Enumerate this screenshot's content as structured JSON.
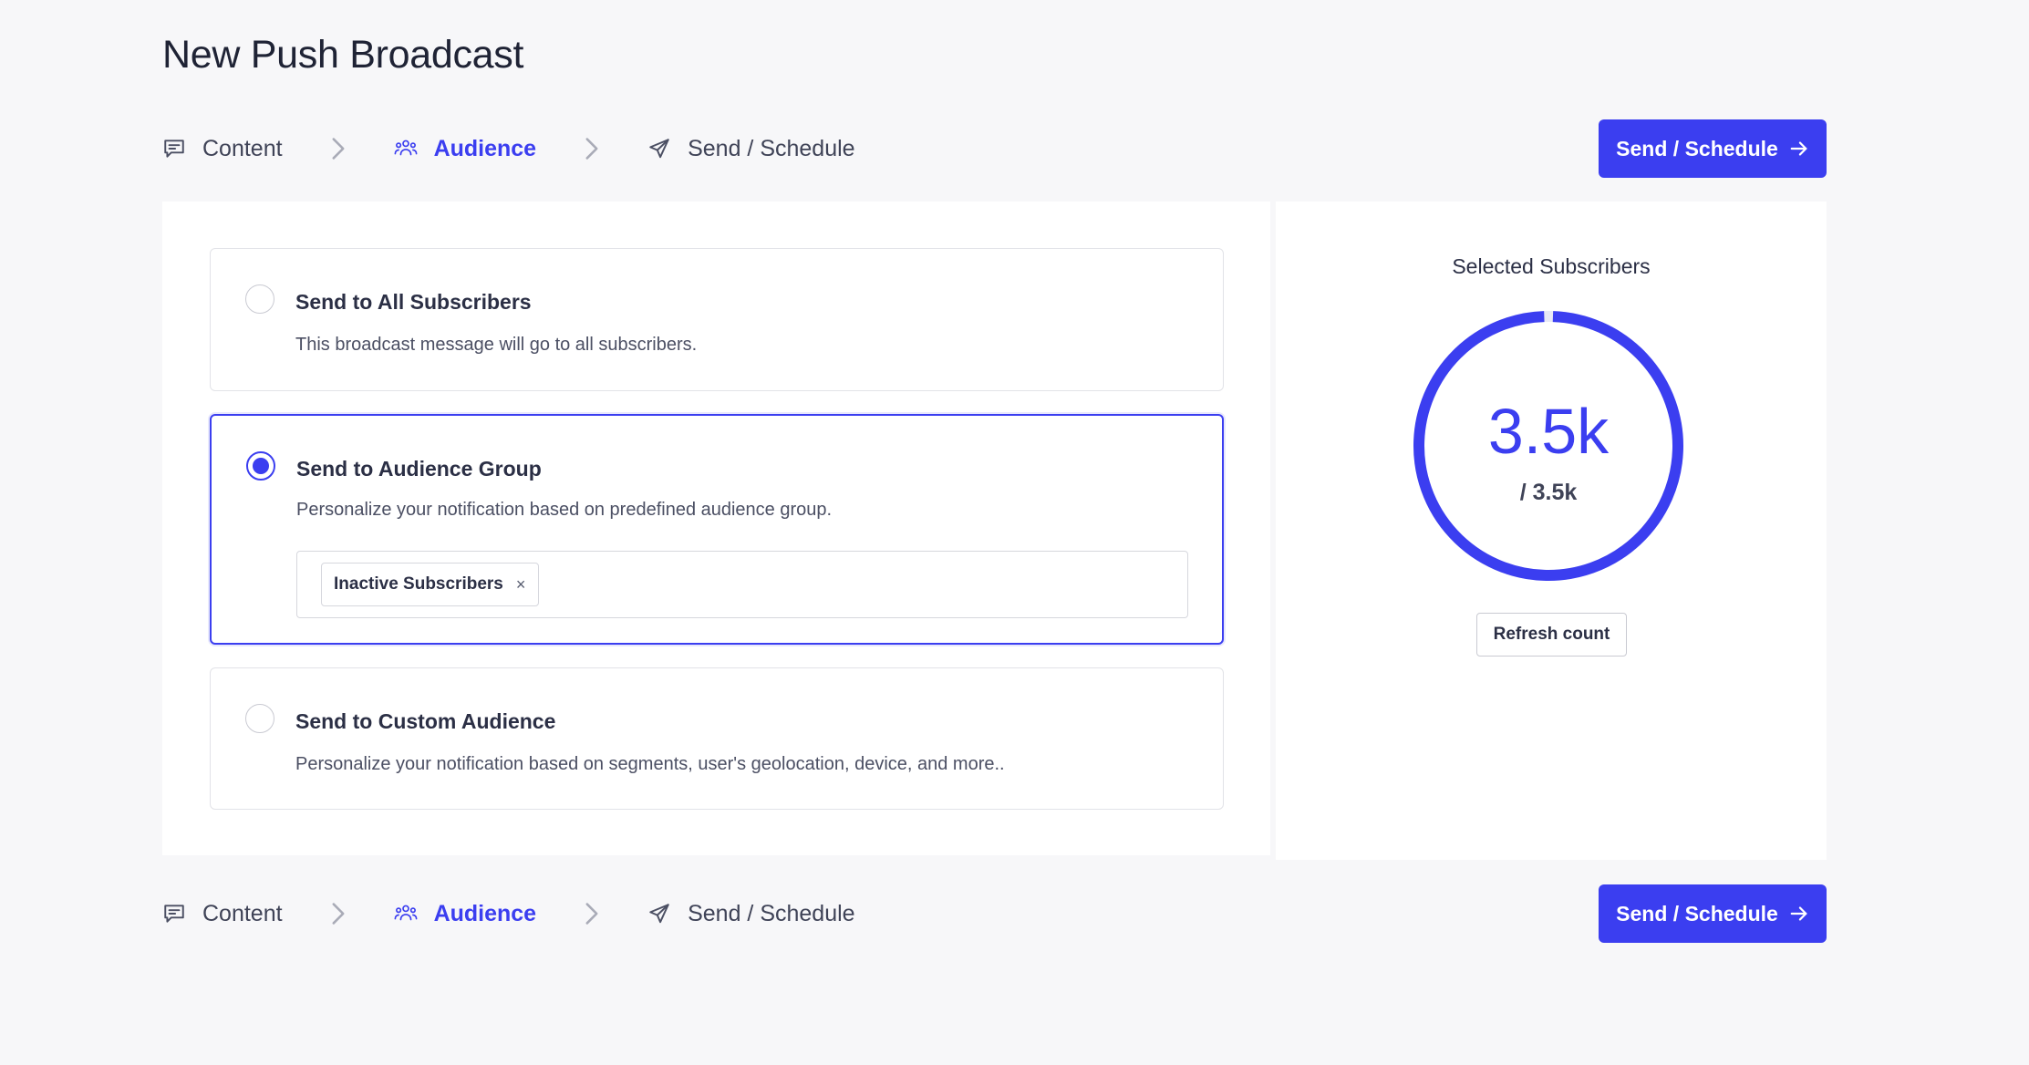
{
  "page": {
    "title": "New Push Broadcast"
  },
  "steps": {
    "content_label": "Content",
    "audience_label": "Audience",
    "send_label": "Send / Schedule",
    "active": "audience"
  },
  "actions": {
    "send_schedule_label": "Send / Schedule"
  },
  "audience_options": [
    {
      "title": "Send to All Subscribers",
      "description": "This broadcast message will go to all subscribers.",
      "selected": false
    },
    {
      "title": "Send to Audience Group",
      "description": "Personalize your notification based on predefined audience group.",
      "selected": true
    },
    {
      "title": "Send to Custom Audience",
      "description": "Personalize your notification based on segments, user's geolocation, device, and more..",
      "selected": false
    }
  ],
  "audience_group": {
    "tags": [
      "Inactive Subscribers"
    ],
    "remove_symbol": "×"
  },
  "subscribers": {
    "title": "Selected Subscribers",
    "selected": "3.5k",
    "total": "/ 3.5k",
    "fraction_selected": 1.0,
    "refresh_label": "Refresh count"
  },
  "colors": {
    "accent": "#3b3ef0",
    "background": "#f7f7f9",
    "panel": "#ffffff",
    "text": "#2b2f45"
  },
  "icons": {
    "content": "message-square-icon",
    "audience": "users-icon",
    "send": "send-icon",
    "separator": "chevron-right-icon",
    "button_arrow": "arrow-right-icon"
  }
}
